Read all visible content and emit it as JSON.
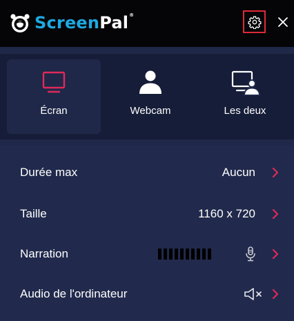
{
  "app": {
    "logo_screen": "Screen",
    "logo_pal": "Pal",
    "logo_tm": "®"
  },
  "header": {
    "settings_icon": "gear-icon",
    "close_icon": "close-icon"
  },
  "modes": [
    {
      "label": "Écran",
      "icon": "monitor-icon",
      "selected": true
    },
    {
      "label": "Webcam",
      "icon": "person-icon",
      "selected": false
    },
    {
      "label": "Les deux",
      "icon": "monitor-person-icon",
      "selected": false
    }
  ],
  "rows": [
    {
      "label": "Durée max",
      "value": "Aucun"
    },
    {
      "label": "Taille",
      "value": "1160 x 720"
    },
    {
      "label": "Narration",
      "value": ""
    },
    {
      "label": "Audio de l'ordinateur",
      "value": ""
    }
  ],
  "narration": {
    "level_bar_count": 10,
    "mic_icon": "microphone-icon"
  },
  "computer_audio": {
    "speaker_icon": "speaker-muted-icon"
  },
  "colors": {
    "accent": "#e0295a",
    "brand_blue": "#1ea8e0",
    "panel_bg": "#212a4c",
    "header_bg": "#050507",
    "settings_highlight": "#e0293a"
  }
}
